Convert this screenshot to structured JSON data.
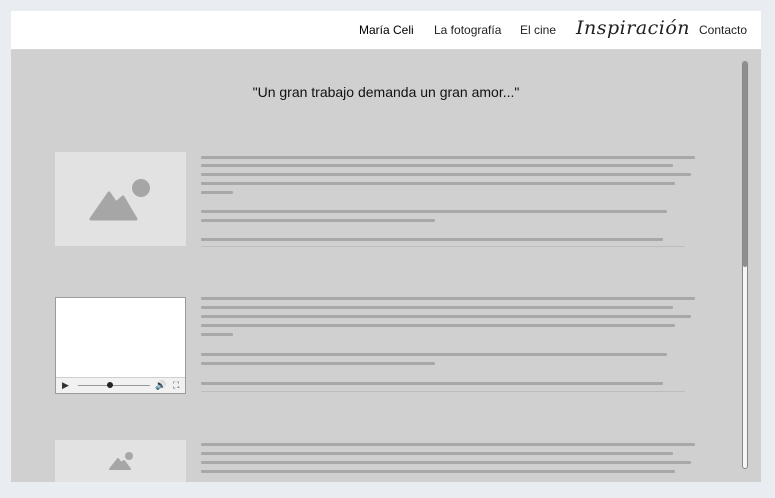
{
  "nav": {
    "items": [
      "María Celi",
      "La fotografía",
      "El cine"
    ],
    "brand": "Inspiración",
    "contact": "Contacto"
  },
  "quote": "\"Un gran trabajo demanda un gran amor...\"",
  "icons": {
    "image": "image-placeholder-icon",
    "play": "play-icon",
    "volume": "volume-icon",
    "fullscreen": "fullscreen-icon"
  },
  "colors": {
    "background": "#d0d0d0",
    "placeholder_text": "#a8a8a8"
  }
}
